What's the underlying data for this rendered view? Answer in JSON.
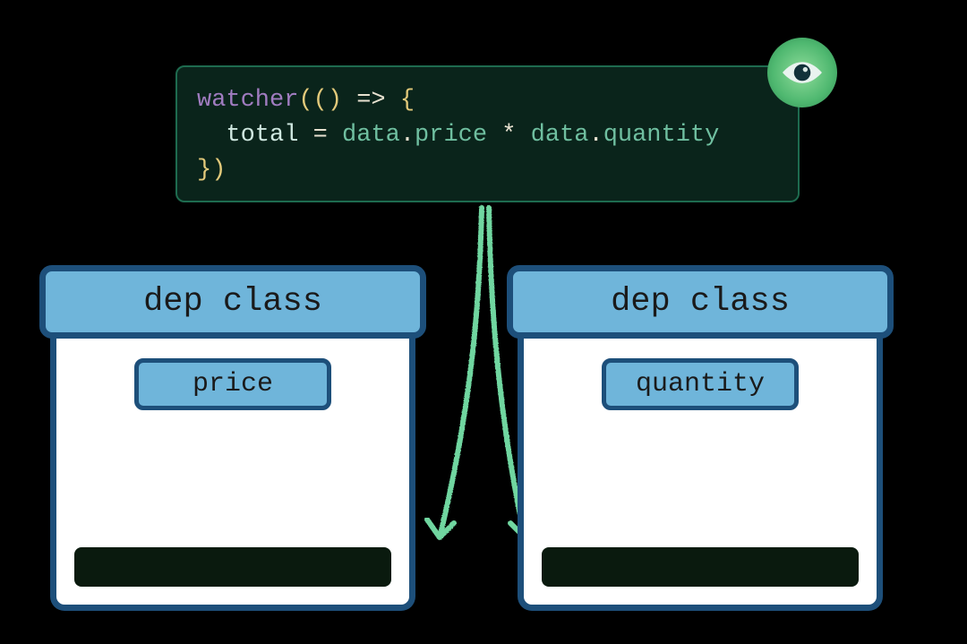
{
  "code": {
    "fn": "watcher",
    "arrow": "=>",
    "lhs": "total",
    "assign": "=",
    "obj1": "data",
    "prop1": "price",
    "op": "*",
    "obj2": "data",
    "prop2": "quantity"
  },
  "dep_left": {
    "header": "dep class",
    "property": "price"
  },
  "dep_right": {
    "header": "dep class",
    "property": "quantity"
  },
  "colors": {
    "code_bg": "#0a241b",
    "code_border": "#1e6b4f",
    "box_blue": "#6fb5da",
    "box_border": "#1d4f7a",
    "arrow": "#6fd6a0"
  }
}
